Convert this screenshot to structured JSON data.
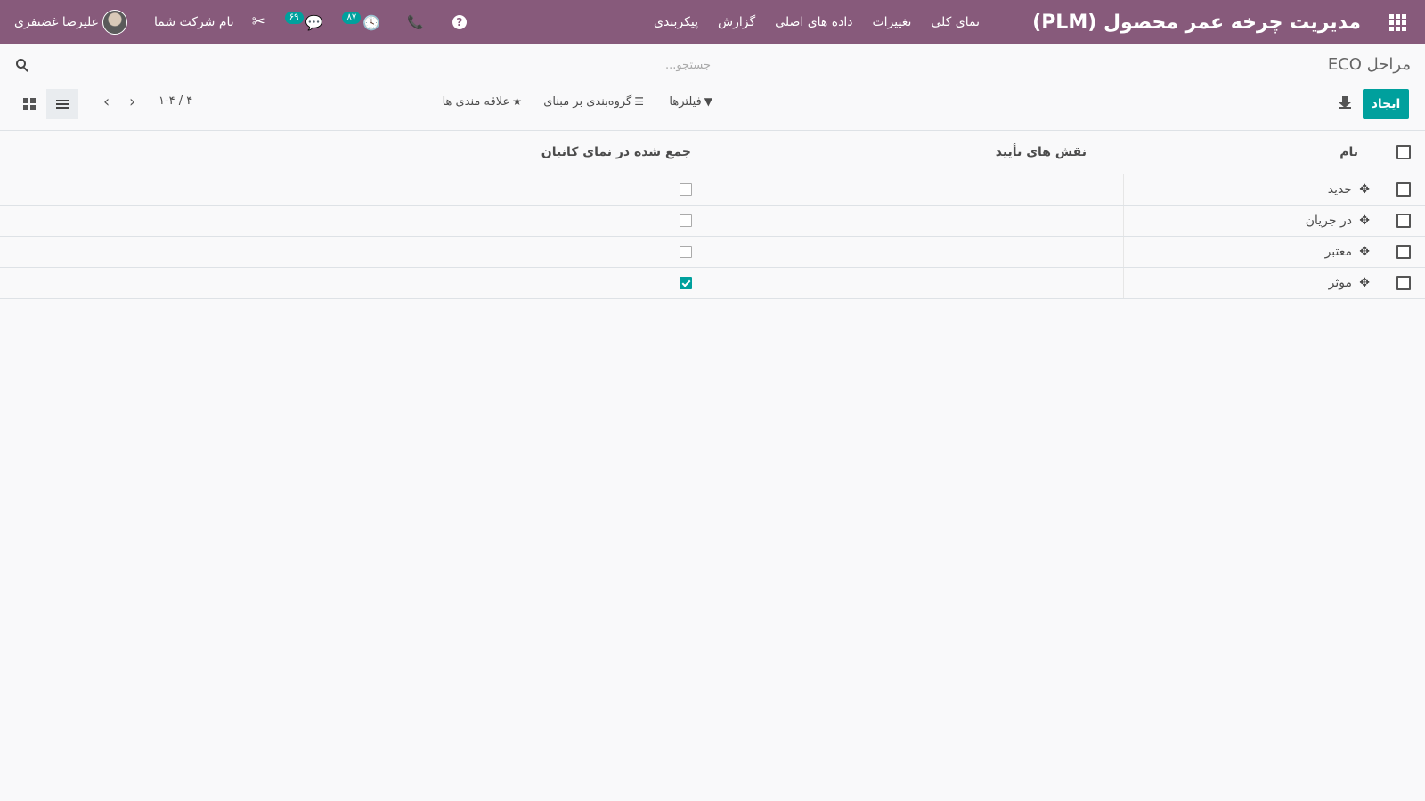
{
  "navbar": {
    "brand": "مدیریت چرخه عمر محصول (PLM)",
    "menu": [
      "نمای کلی",
      "تغییرات",
      "داده های اصلی",
      "گزارش",
      "پیکربندی"
    ],
    "user_name": "علیرضا غضنفری",
    "company": "نام شرکت شما",
    "activity_badge": "۸۷",
    "messages_badge": "۶۹",
    "help_glyph": "?"
  },
  "control": {
    "title": "مراحل ECO",
    "search_placeholder": "جستجو...",
    "create_label": "ایجاد",
    "filters_label": "فیلترها",
    "groupby_label": "گروه‌بندی بر مبنای",
    "favorites_label": "علاقه مندی ها",
    "pager": "۱-۴ / ۴"
  },
  "table": {
    "headers": {
      "name": "نام",
      "approval_roles": "نقش های تأیید",
      "folded": "جمع شده در نمای کانبان"
    },
    "rows": [
      {
        "name": "جدید",
        "folded": false
      },
      {
        "name": "در جریان",
        "folded": false
      },
      {
        "name": "معتبر",
        "folded": false
      },
      {
        "name": "موثر",
        "folded": true
      }
    ]
  },
  "colors": {
    "navbar": "#875a7b",
    "primary": "#00a09d"
  }
}
